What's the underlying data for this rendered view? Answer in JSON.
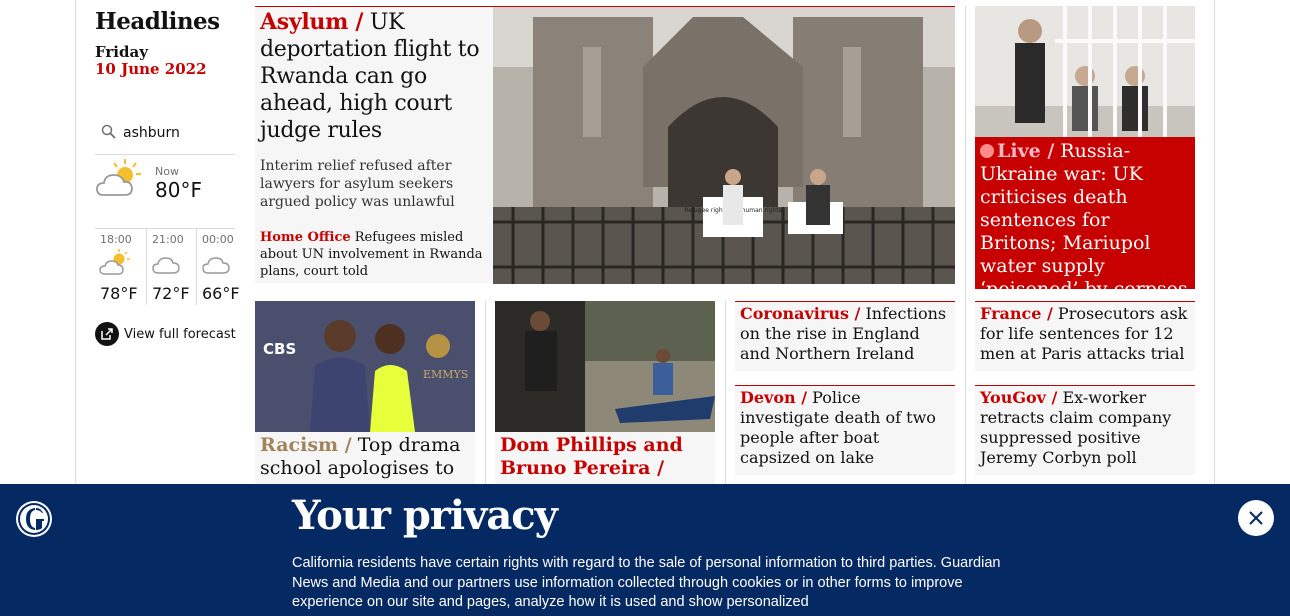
{
  "sidebar": {
    "title": "Headlines",
    "day": "Friday",
    "date": "10 June 2022",
    "location": "ashburn",
    "now_label": "Now",
    "now_temp": "80°F",
    "forecast": [
      {
        "time": "18:00",
        "temp": "78°F",
        "icon": "partly-sunny-icon"
      },
      {
        "time": "21:00",
        "temp": "72°F",
        "icon": "cloud-icon"
      },
      {
        "time": "00:00",
        "temp": "66°F",
        "icon": "cloud-icon"
      }
    ],
    "view_forecast": "View full forecast"
  },
  "main_story": {
    "kicker": "Asylum /",
    "headline": " UK deportation flight to Rwanda can go ahead, high court judge rules",
    "standfirst": "Interim relief refused after lawyers for asylum seekers argued policy was unlawful",
    "sublink_kicker": "Home Office",
    "sublink_text": " Refugees misled about UN involvement in Rwanda plans, court told"
  },
  "live_story": {
    "kicker": "Live /",
    "headline": " Russia-Ukraine war: UK criticises death sentences for Britons; Mariupol water supply ‘poisoned’ by corpses"
  },
  "cards": [
    {
      "kicker": "Coronavirus /",
      "headline": " Infections on the rise in England and Northern Ireland"
    },
    {
      "kicker": "Devon /",
      "headline": " Police investigate death of two people after boat capsized on lake"
    },
    {
      "kicker": "France /",
      "headline": " Prosecutors ask for life sentences for 12 men at Paris attacks trial"
    },
    {
      "kicker": "YouGov /",
      "headline": " Ex-worker retracts claim company suppressed positive Jeremy Corbyn poll"
    }
  ],
  "photo_cards": [
    {
      "kicker": "Racism /",
      "headline": " Top drama school apologises to"
    },
    {
      "kicker": "Dom Phillips and Bruno Pereira /",
      "headline": ""
    }
  ],
  "photo_text": {
    "sign_left": "Refugee rights are human rights",
    "cbs": "CBS",
    "emmys": "EMMYS"
  },
  "privacy": {
    "title": "Your privacy",
    "body": "California residents have certain rights with regard to the sale of personal information to third parties. Guardian News and Media and our partners use information collected through cookies or in other forms to improve experience on our site and pages, analyze how it is used and show personalized"
  },
  "colors": {
    "news_red": "#c70000",
    "navy": "#052962",
    "tan": "#a1845c"
  }
}
